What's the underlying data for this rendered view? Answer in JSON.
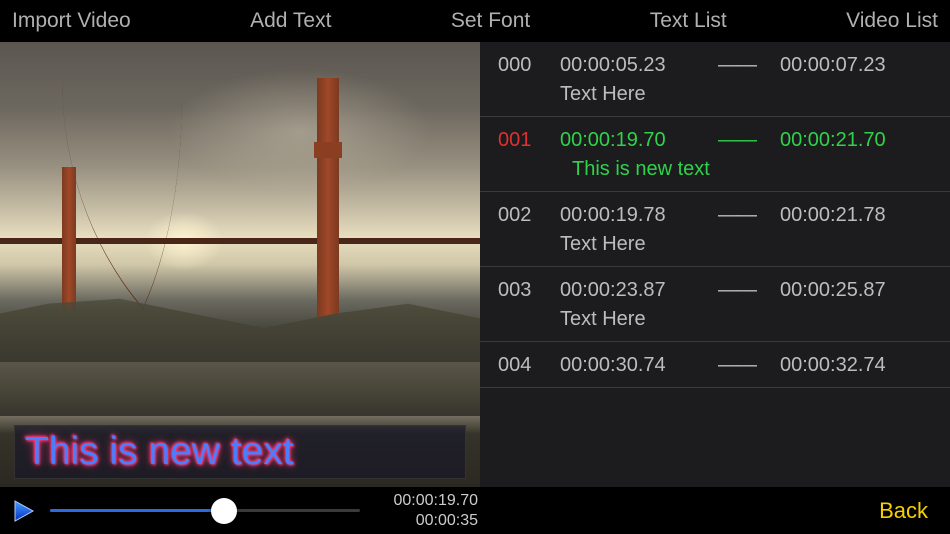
{
  "topbar": {
    "import": "Import Video",
    "add_text": "Add Text",
    "set_font": "Set Font",
    "text_list": "Text List",
    "video_list": "Video List"
  },
  "overlay_text": "This is new text",
  "playback": {
    "current_time": "00:00:19.70",
    "duration": "00:00:35",
    "progress_pct": 56
  },
  "rows": [
    {
      "idx": "000",
      "start": "00:00:05.23",
      "end": "00:00:07.23",
      "text": "Text Here",
      "active": false
    },
    {
      "idx": "001",
      "start": "00:00:19.70",
      "end": "00:00:21.70",
      "text": "This is new text",
      "active": true
    },
    {
      "idx": "002",
      "start": "00:00:19.78",
      "end": "00:00:21.78",
      "text": "Text Here",
      "active": false
    },
    {
      "idx": "003",
      "start": "00:00:23.87",
      "end": "00:00:25.87",
      "text": "Text Here",
      "active": false
    },
    {
      "idx": "004",
      "start": "00:00:30.74",
      "end": "00:00:32.74",
      "text": "",
      "active": false
    }
  ],
  "back_label": "Back",
  "dash": "——"
}
